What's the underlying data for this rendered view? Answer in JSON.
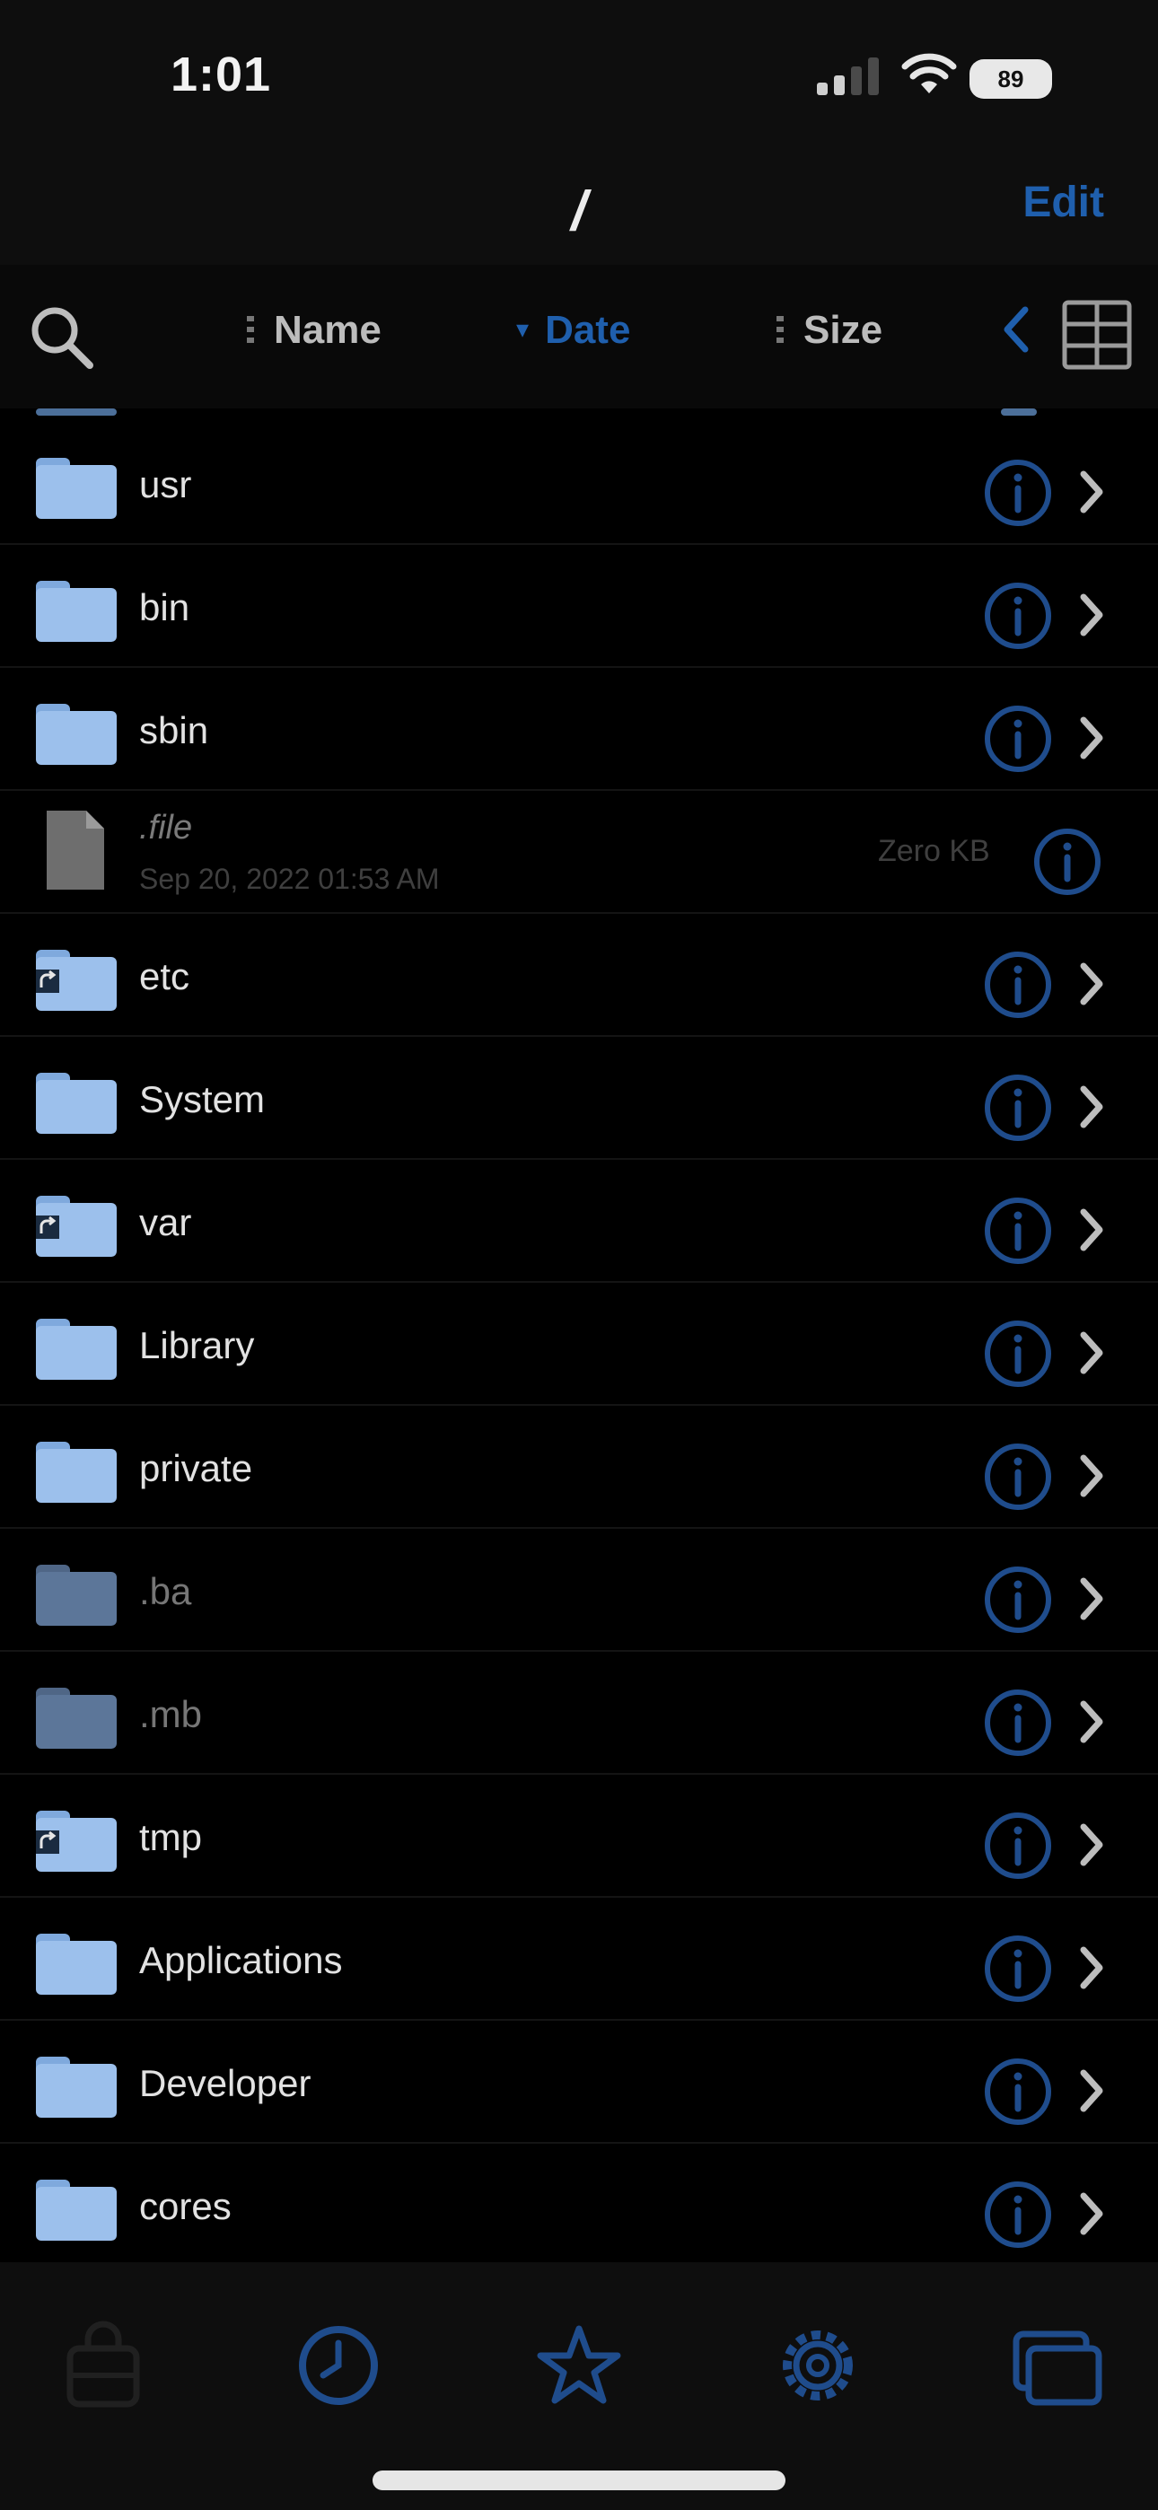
{
  "status_bar": {
    "time": "1:01",
    "battery": "89"
  },
  "nav": {
    "title": "/",
    "edit_label": "Edit"
  },
  "sort_bar": {
    "name_label": "Name",
    "date_label": "Date",
    "size_label": "Size",
    "active_sort": "Date",
    "accent_color": "#1f5fad"
  },
  "rows": [
    {
      "type": "folder",
      "name": "usr"
    },
    {
      "type": "folder",
      "name": "bin"
    },
    {
      "type": "folder",
      "name": "sbin"
    },
    {
      "type": "file",
      "name": ".file",
      "date": "Sep 20, 2022 01:53 AM",
      "size": "Zero KB"
    },
    {
      "type": "folder-link",
      "name": "etc"
    },
    {
      "type": "folder",
      "name": "System"
    },
    {
      "type": "folder-link",
      "name": "var"
    },
    {
      "type": "folder",
      "name": "Library"
    },
    {
      "type": "folder",
      "name": "private"
    },
    {
      "type": "folder-hidden",
      "name": ".ba"
    },
    {
      "type": "folder-hidden",
      "name": ".mb"
    },
    {
      "type": "folder-link",
      "name": "tmp"
    },
    {
      "type": "folder",
      "name": "Applications"
    },
    {
      "type": "folder",
      "name": "Developer"
    },
    {
      "type": "folder",
      "name": "cores"
    }
  ],
  "tab_bar": {
    "items": [
      {
        "icon": "bag-icon",
        "active": false
      },
      {
        "icon": "clock-icon",
        "active": true
      },
      {
        "icon": "star-icon",
        "active": true
      },
      {
        "icon": "gear-icon",
        "active": true
      },
      {
        "icon": "windows-icon",
        "active": true
      }
    ]
  }
}
